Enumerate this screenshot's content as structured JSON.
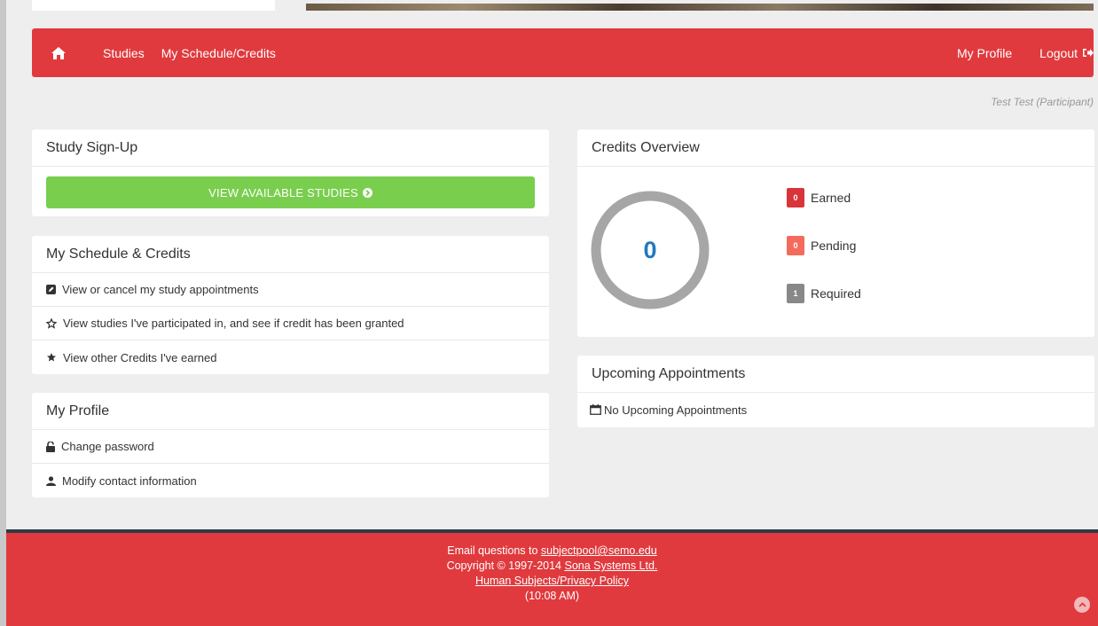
{
  "navbar": {
    "home_icon": "home-icon",
    "links": [
      "Studies",
      "My Schedule/Credits"
    ],
    "profile": "My Profile",
    "logout": "Logout",
    "logout_icon": "sign-out-icon",
    "color": "#e03a3e"
  },
  "user_line": "Test Test (Participant)",
  "signup": {
    "title": "Study Sign-Up",
    "button": "VIEW AVAILABLE STUDIES",
    "button_icon": "circle-arrow-right-icon",
    "button_color": "#79ce4e"
  },
  "schedule": {
    "title": "My Schedule & Credits",
    "items": [
      {
        "label": "View or cancel my study appointments",
        "icon": "edit-square-icon"
      },
      {
        "label": "View studies I've participated in, and see if credit has been granted",
        "icon": "star-outline-icon"
      },
      {
        "label": "View other Credits I've earned",
        "icon": "star-icon"
      }
    ]
  },
  "profile": {
    "title": "My Profile",
    "items": [
      {
        "label": "Change password",
        "icon": "unlock-icon"
      },
      {
        "label": "Modify contact information",
        "icon": "user-icon"
      }
    ]
  },
  "credits": {
    "title": "Credits Overview",
    "total": "0",
    "legend": [
      {
        "count": "0",
        "label": "Earned",
        "color": "#d9343a"
      },
      {
        "count": "0",
        "label": "Pending",
        "color": "#f46b5d"
      },
      {
        "count": "1",
        "label": "Required",
        "color": "#888888"
      }
    ]
  },
  "upcoming": {
    "title": "Upcoming Appointments",
    "empty": "No Upcoming Appointments",
    "icon": "calendar-icon"
  },
  "footer": {
    "email_prefix": "Email questions to ",
    "email": "subjectpool@semo.edu",
    "copyright_prefix": "Copyright © 1997-2014 ",
    "company": "Sona Systems Ltd.",
    "policy": "Human Subjects/Privacy Policy",
    "time": "(10:08 AM)"
  }
}
